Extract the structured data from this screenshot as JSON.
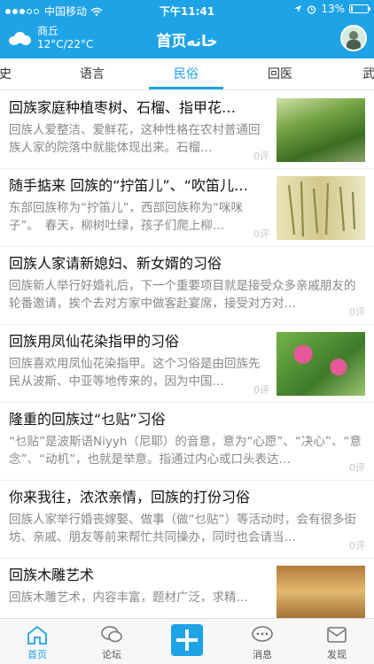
{
  "status_bar": {
    "carrier": "中国移动",
    "time": "下午11:41",
    "battery": "13%",
    "battery_level": 0.13
  },
  "header": {
    "city": "商丘",
    "temperature": "12°C/22°C",
    "title": "首页",
    "title_arabic": "خانه"
  },
  "tabs": [
    {
      "label": "史"
    },
    {
      "label": "语言"
    },
    {
      "label": "民俗"
    },
    {
      "label": "回医"
    },
    {
      "label": "武"
    }
  ],
  "active_tab": "民俗",
  "articles": [
    {
      "title": "回族家庭种植枣树、石榴、指甲花…",
      "desc": "回族人爱整洁、爱鲜花，这种性格在农村普通回族人家的院落中就能体现出来。石榴…",
      "comments": "0评",
      "thumb": "green-leaves-image"
    },
    {
      "title": "随手掂来 回族的“拧笛儿”、“吹笛儿…",
      "desc": "东部回族称为“拧笛儿”，西部回族称为“咪咪子”。　春天，柳树吐绿，孩子们爬上柳…",
      "comments": "0评",
      "thumb": "reed-whistles-image"
    },
    {
      "title": "回族人家请新媳妇、新女婿的习俗",
      "desc": "回族新人举行好婚礼后，下一个重要项目就是接受众多亲戚朋友的轮番邀请，挨个去对方家中做客赴宴席，接受对方对…",
      "comments": "0评",
      "thumb": null
    },
    {
      "title": "回族用凤仙花染指甲的习俗",
      "desc": "回族喜欢用凤仙花染指甲。这个习俗是由回族先民从波斯、中亚等地传来的，因为中国…",
      "comments": "0评",
      "thumb": "balsam-flowers-image"
    },
    {
      "title": "隆重的回族过“乜贴”习俗",
      "desc": "“乜贴”是波斯语Niyyh（尼耶）的音意，意为“心愿”、“决心”、“意念”、“动机”，也就是举意。指通过内心或口头表达…",
      "comments": "0评",
      "thumb": null
    },
    {
      "title": "你来我往，浓浓亲情，回族的打份习俗",
      "desc": "回族人家举行婚丧嫁娶、做事（做“乜贴”）等活动时，会有很多街坊、亲戚、朋友等前来帮忙共同操办，同时也会请当…",
      "comments": "0评",
      "thumb": null
    },
    {
      "title": "回族木雕艺术",
      "desc": "回族木雕艺术，内容丰富，题材广泛，求精…",
      "comments": "",
      "thumb": "wood-carving-image"
    }
  ],
  "bottom_nav": [
    {
      "label": "首页",
      "icon": "home-icon"
    },
    {
      "label": "论坛",
      "icon": "chat-bubble-icon"
    },
    {
      "label": "",
      "icon": "plus-icon"
    },
    {
      "label": "消息",
      "icon": "message-icon"
    },
    {
      "label": "发现",
      "icon": "discover-icon"
    }
  ],
  "colors": {
    "accent": "#1ea3e6"
  }
}
